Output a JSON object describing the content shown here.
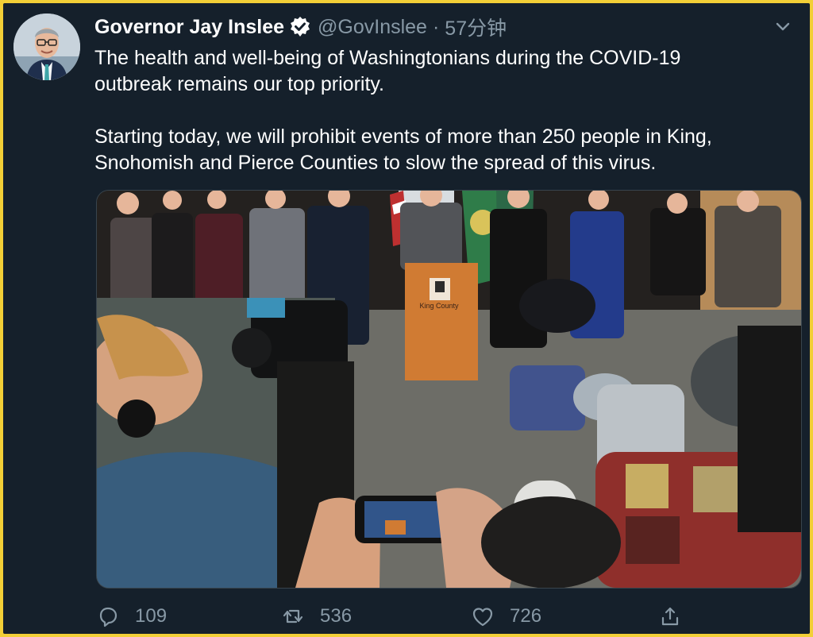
{
  "tweet": {
    "author_name": "Governor Jay Inslee",
    "handle": "@GovInslee",
    "separator": "·",
    "timestamp": "57分钟",
    "text": "The health and well-being of Washingtonians during the COVID-19\noutbreak remains our top priority.\n\nStarting today, we will prohibit events of more than 250 people in King,\nSnohomish and Pierce Counties to slow the spread of this virus."
  },
  "media": {
    "podium_logo_text": "King County"
  },
  "actions": {
    "reply_count": "109",
    "retweet_count": "536",
    "like_count": "726"
  },
  "icons": {
    "verified": "verified-badge-icon",
    "caret": "chevron-down-icon",
    "reply": "reply-bubble-icon",
    "retweet": "retweet-arrows-icon",
    "like": "heart-icon",
    "share": "share-upload-icon"
  },
  "colors": {
    "background": "#15202b",
    "frame": "#f2cf37",
    "text": "#ffffff",
    "muted": "#8899a6"
  }
}
